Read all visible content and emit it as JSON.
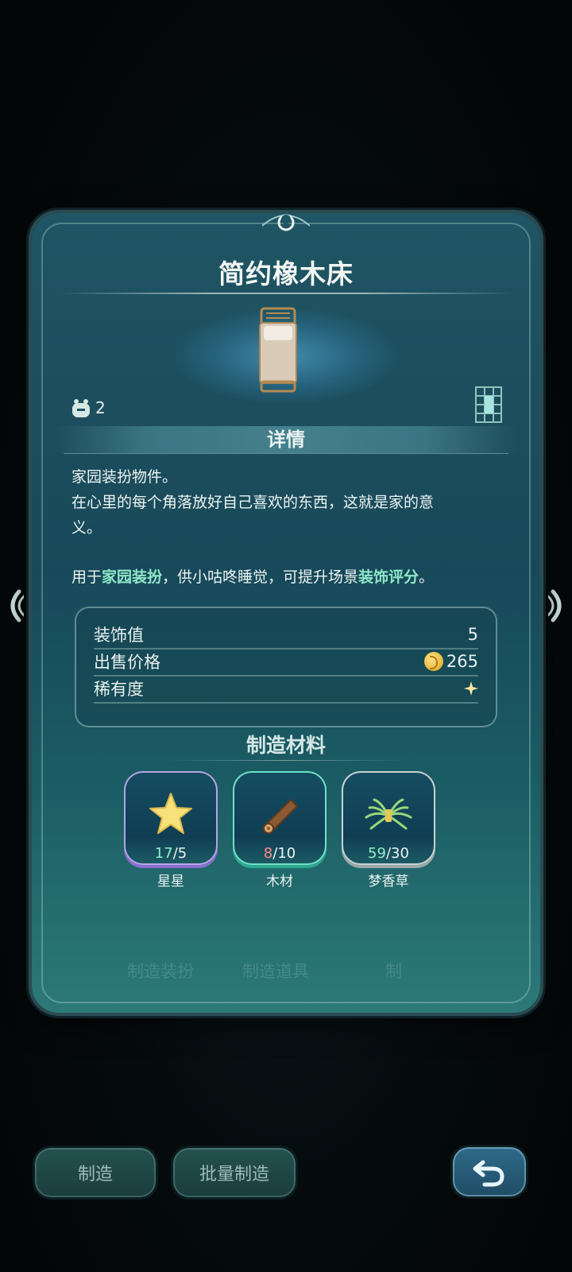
{
  "item": {
    "title": "简约橡木床",
    "capacity": "2"
  },
  "details": {
    "heading": "详情",
    "description": [
      "家园装扮物件。",
      "在心里的每个角落放好自己喜欢的东西，这就是家的意",
      "义。"
    ],
    "usage": {
      "prefix": "用于",
      "highlight1": "家园装扮",
      "middle": "，供小咕咚睡觉，可提升场景",
      "highlight2": "装饰评分",
      "suffix": "。"
    }
  },
  "stats": [
    {
      "label": "装饰值",
      "value": "5"
    },
    {
      "label": "出售价格",
      "value": "265"
    },
    {
      "label": "稀有度",
      "value": ""
    }
  ],
  "materials": {
    "heading": "制造材料",
    "items": [
      {
        "name": "星星",
        "have": "17",
        "need": "5",
        "icon": "star-icon"
      },
      {
        "name": "木材",
        "have": "8",
        "need": "10",
        "icon": "log-icon"
      },
      {
        "name": "梦香草",
        "have": "59",
        "need": "30",
        "icon": "grass-bundle-icon"
      }
    ]
  },
  "background_tabs": [
    "制造装扮",
    "制造道具",
    "制"
  ],
  "buttons": {
    "craft": "制造",
    "batch_craft": "批量制造"
  },
  "colors": {
    "accent_green": "#8fe8c8",
    "insufficient_red": "#ff8a8a",
    "coin_gold": "#e6b43a"
  }
}
